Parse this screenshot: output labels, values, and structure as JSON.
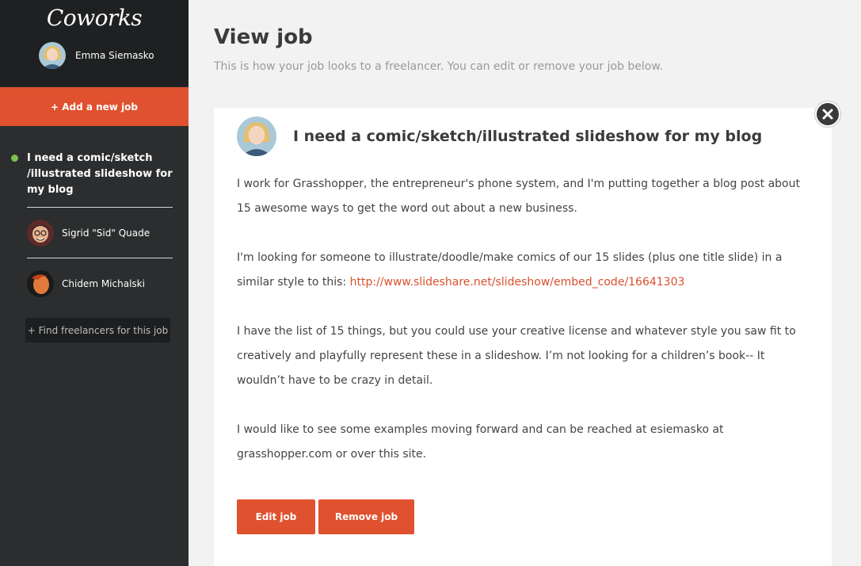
{
  "sidebar": {
    "brand": "Coworks",
    "user_name": "Emma Siemasko",
    "add_job_label": "+ Add a new job",
    "active_job_title": "I need a comic/sketch /illustrated slideshow for my blog",
    "freelancers": [
      {
        "name": "Sigrid \"Sid\" Quade"
      },
      {
        "name": "Chidem Michalski"
      }
    ],
    "find_label": "+ Find freelancers for this job"
  },
  "main": {
    "title": "View job",
    "subtitle": "This is how your job looks to a freelancer. You can edit or remove your job below.",
    "job": {
      "title": "I need a comic/sketch/illustrated slideshow for my blog",
      "p1": "I work for Grasshopper, the entrepreneur's phone system, and I'm putting together a blog post about 15 awesome ways to get the word out about a new business.",
      "p2_text": "I'm looking for someone to illustrate/doodle/make comics of our 15 slides (plus one title slide) in a similar style to this: ",
      "p2_link": "http://www.slideshare.net/slideshow/embed_code/16641303",
      "p3": "I have the list of 15 things, but you could use your creative license and whatever style you saw fit to creatively and playfully represent these in a slideshow. I’m not looking for a children’s book-- It wouldn’t have to be crazy in detail.",
      "p4": "I would like to see some examples moving forward and can be reached at esiemasko at grasshopper.com or over this site."
    },
    "edit_label": "Edit job",
    "remove_label": "Remove job"
  },
  "colors": {
    "accent": "#e0512f",
    "sidebar_bg": "#2b2d2e",
    "status_online": "#7fbf4d",
    "link": "#d9502d"
  }
}
